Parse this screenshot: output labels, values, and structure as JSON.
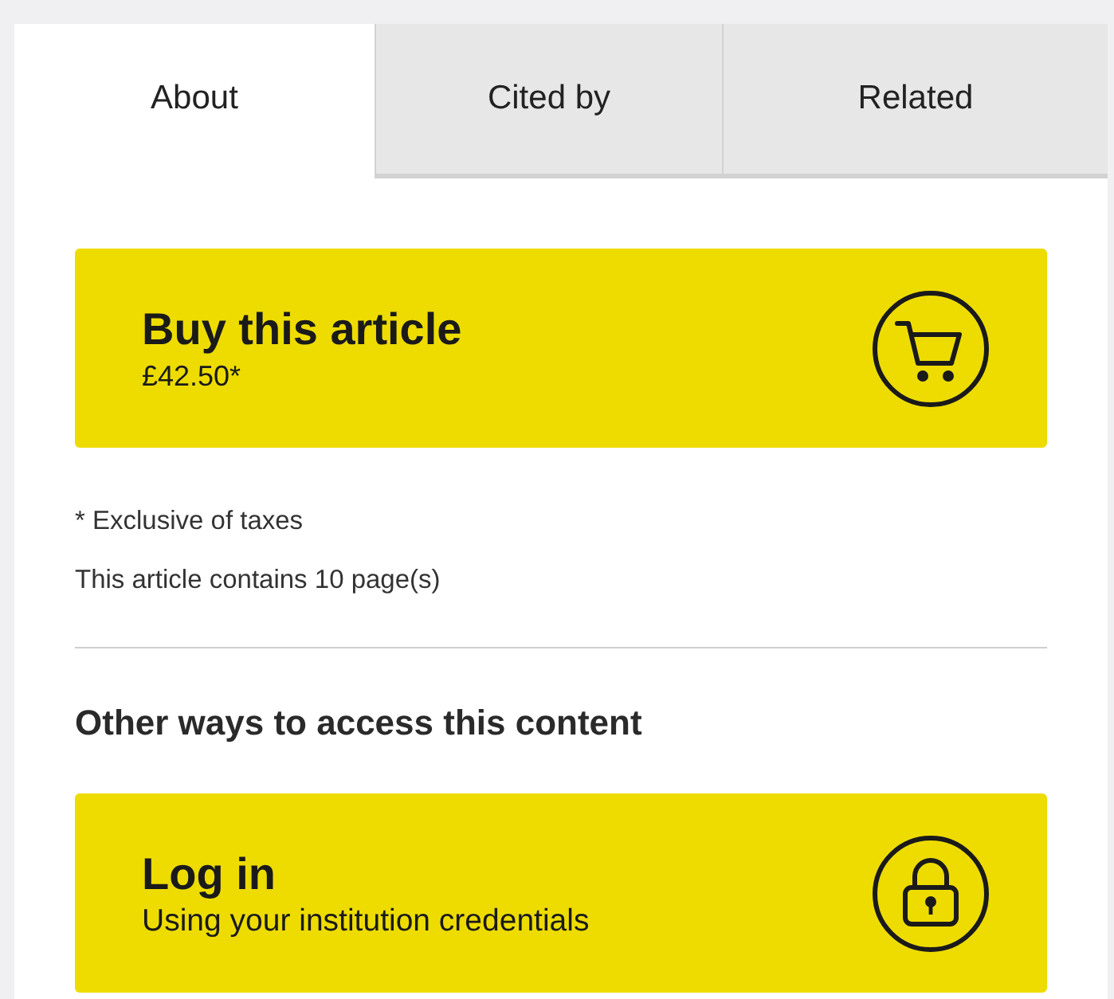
{
  "tabs": [
    {
      "label": "About",
      "selected": true
    },
    {
      "label": "Cited by",
      "selected": false
    },
    {
      "label": "Related",
      "selected": false
    }
  ],
  "purchase": {
    "title": "Buy this article",
    "price": "£42.50*"
  },
  "notes": [
    "* Exclusive of taxes",
    "This article contains 10 page(s)"
  ],
  "other_access": {
    "heading": "Other ways to access this content",
    "login": {
      "title": "Log in",
      "subtitle": "Using your institution credentials"
    }
  }
}
